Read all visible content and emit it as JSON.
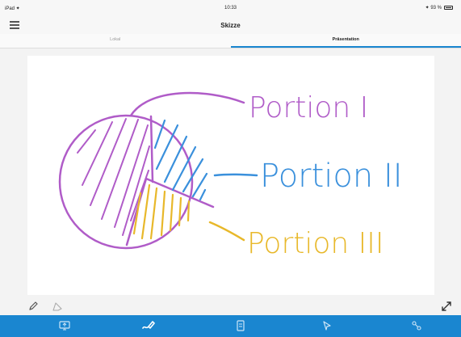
{
  "status_bar": {
    "carrier": "iPad ✦",
    "time": "10:33",
    "battery": "✦ 93 %"
  },
  "header": {
    "title": "Skizze"
  },
  "tabs": [
    {
      "label": "Lokal",
      "active": false
    },
    {
      "label": "Präsentation",
      "active": true
    }
  ],
  "sketch": {
    "labels": [
      "Portion I",
      "Portion II",
      "Portion III"
    ],
    "colors": {
      "purple": "#b05cc8",
      "blue": "#3a90dc",
      "yellow": "#e8b82a"
    }
  },
  "toolbar": {
    "icons": [
      "pencil-icon",
      "eraser-icon",
      "expand-icon"
    ]
  },
  "tab_bar": {
    "color": "#1a86d0",
    "icons": [
      "screen-share-icon",
      "draw-icon",
      "document-icon",
      "pointer-icon",
      "connect-icon"
    ]
  }
}
